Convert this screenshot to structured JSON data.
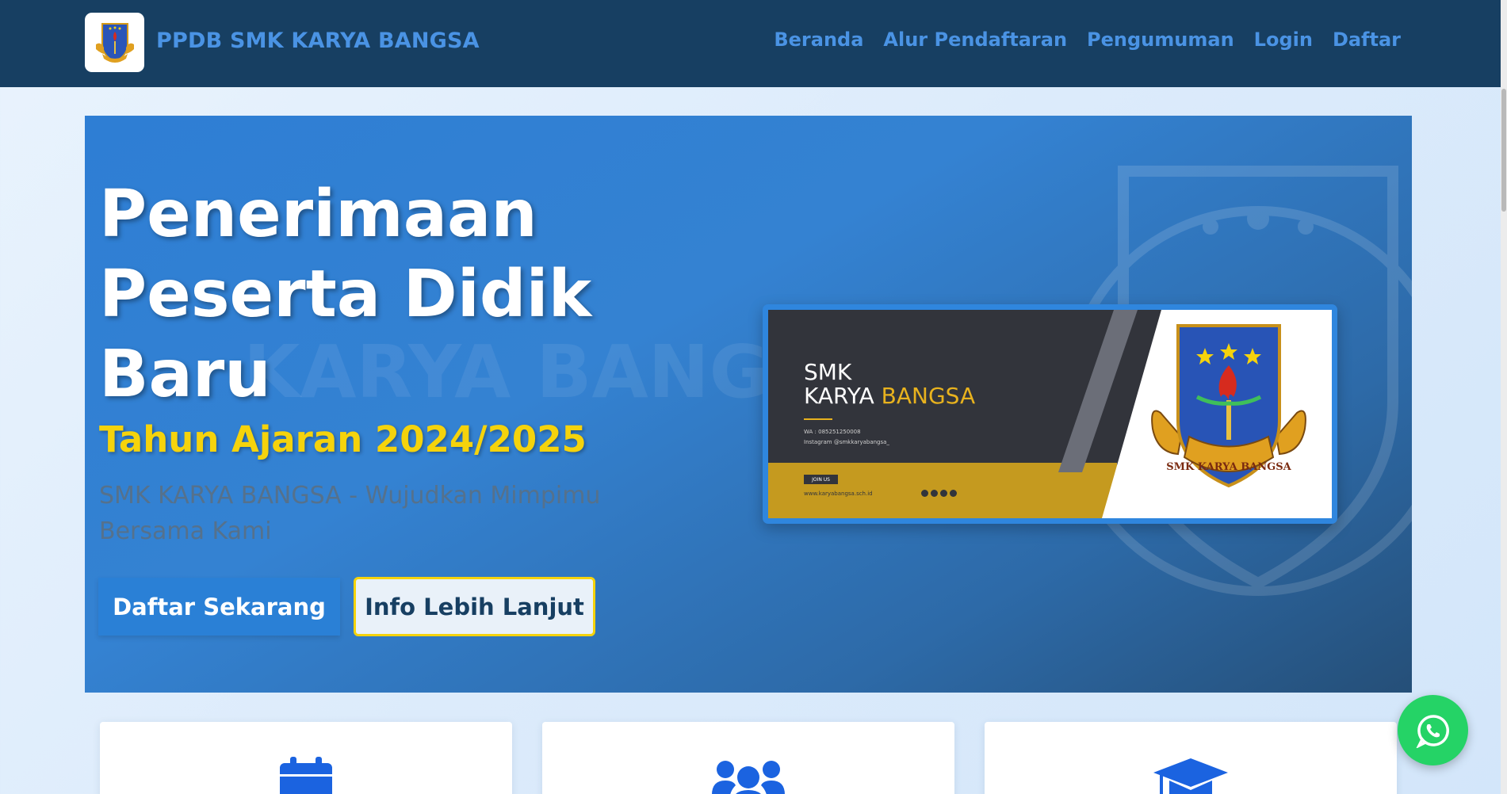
{
  "navbar": {
    "brand": "PPDB SMK KARYA BANGSA",
    "links": [
      {
        "label": "Beranda"
      },
      {
        "label": "Alur Pendaftaran"
      },
      {
        "label": "Pengumuman"
      },
      {
        "label": "Login"
      },
      {
        "label": "Daftar"
      }
    ]
  },
  "hero": {
    "title": "Penerimaan Peserta Didik Baru",
    "subtitle": "Tahun Ajaran 2024/2025",
    "tagline": "SMK KARYA BANGSA - Wujudkan Mimpimu Bersama Kami",
    "primary_button": "Daftar Sekarang",
    "secondary_button": "Info Lebih Lanjut",
    "watermark_text": "KARYA BANGSA"
  },
  "banner": {
    "line1": "SMK",
    "line2_a": "KARYA ",
    "line2_b": "BANGSA",
    "wa": "WA : 085251250008",
    "instagram": "Instagram @smkkaryabangsa_",
    "join": "JOIN US",
    "website": "www.karyabangsa.sch.id",
    "emblem_text": "SMK KARYA BANGSA"
  },
  "features": [
    {
      "icon": "calendar-icon"
    },
    {
      "icon": "users-icon"
    },
    {
      "icon": "graduation-cap-icon"
    }
  ],
  "whatsapp": {
    "icon": "whatsapp-icon"
  },
  "colors": {
    "navbar": "#173f62",
    "brand_blue": "#4a93e4",
    "hero_blue": "#2e7ed4",
    "accent_yellow": "#f5d30c",
    "whatsapp_green": "#25d366",
    "icon_blue": "#1b63e0"
  }
}
